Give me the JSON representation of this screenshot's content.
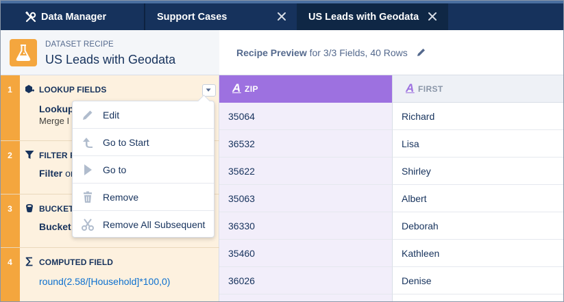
{
  "tabs": {
    "app_label": "Data Manager",
    "items": [
      {
        "label": "Support Cases",
        "active": false
      },
      {
        "label": "US Leads with Geodata",
        "active": true
      }
    ]
  },
  "recipe": {
    "kicker": "DATASET RECIPE",
    "title": "US Leads with Geodata",
    "icon": "flask-icon"
  },
  "steps": [
    {
      "number": "1",
      "type": "LOOKUP FIELDS",
      "icon": "lookup-icon",
      "title": "Lookup",
      "description": "Merge I"
    },
    {
      "number": "2",
      "type": "FILTER R",
      "icon": "filter-icon",
      "title": "Filter",
      "title_suffix": "or"
    },
    {
      "number": "3",
      "type": "BUCKET",
      "icon": "bucket-icon",
      "title": "Bucket"
    },
    {
      "number": "4",
      "type": "COMPUTED FIELD",
      "icon": "sigma-icon",
      "formula": "round(2.58/[Household]*100,0)"
    }
  ],
  "menu": {
    "items": [
      {
        "label": "Edit",
        "icon": "pencil-icon"
      },
      {
        "label": "Go to Start",
        "icon": "go-to-start-icon"
      },
      {
        "label": "Go to",
        "icon": "play-icon"
      },
      {
        "label": "Remove",
        "icon": "trash-icon"
      },
      {
        "label": "Remove All Subsequent",
        "icon": "scissors-icon"
      }
    ]
  },
  "preview": {
    "title": "Recipe Preview",
    "subtitle": " for 3/3 Fields, 40 Rows"
  },
  "grid": {
    "type_glyph": "A",
    "columns": [
      "ZIP",
      "FIRST"
    ],
    "rows": [
      [
        "35064",
        "Richard"
      ],
      [
        "36532",
        "Lisa"
      ],
      [
        "35622",
        "Shirley"
      ],
      [
        "35063",
        "Albert"
      ],
      [
        "36330",
        "Deborah"
      ],
      [
        "35460",
        "Kathleen"
      ],
      [
        "36026",
        "Denise"
      ]
    ]
  },
  "colors": {
    "nav": "#16325c",
    "step_accent": "#f4a63e",
    "zip_column": "#9d71e0",
    "formula": "#0b6fcf"
  }
}
